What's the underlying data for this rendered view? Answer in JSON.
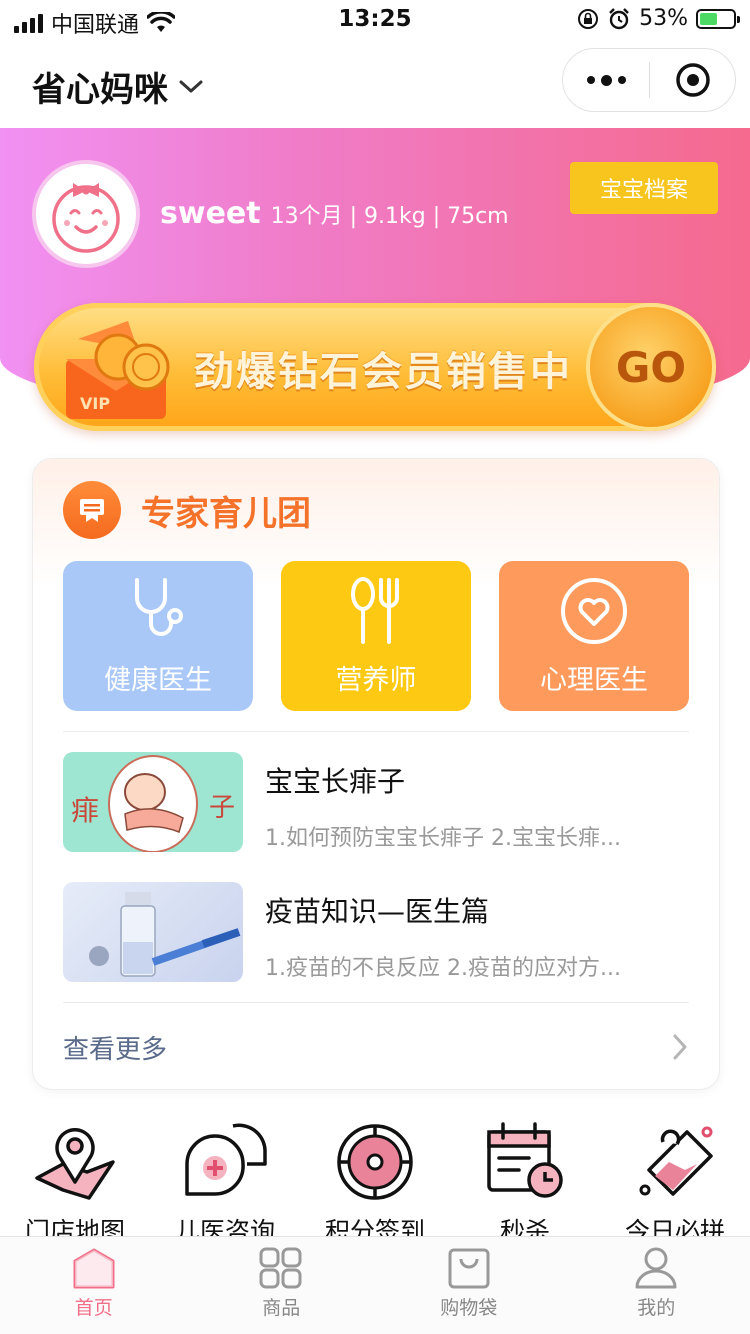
{
  "status_bar": {
    "carrier": "中国联通",
    "time": "13:25",
    "battery_percent": "53%",
    "battery_level": 0.53
  },
  "nav": {
    "title": "省心妈咪"
  },
  "baby": {
    "name": "sweet",
    "info": "13个月 | 9.1kg | 75cm",
    "archive_button": "宝宝档案"
  },
  "promo": {
    "text": "劲爆钻石会员销售中",
    "go_label": "GO",
    "vip_label": "VIP"
  },
  "expert": {
    "title": "专家育儿团",
    "tiles": [
      {
        "label": "健康医生",
        "color": "#a9c8f8",
        "icon": "stethoscope-icon"
      },
      {
        "label": "营养师",
        "color": "#fdc912",
        "icon": "spoon-fork-icon"
      },
      {
        "label": "心理医生",
        "color": "#fe9a5c",
        "icon": "heart-circle-icon"
      }
    ],
    "articles": [
      {
        "title": "宝宝长痱子",
        "desc": "1.如何预防宝宝长痱子 2.宝宝长痱...",
        "thumb_text_left": "痱",
        "thumb_text_right": "子"
      },
      {
        "title": "疫苗知识—医生篇",
        "desc": "1.疫苗的不良反应 2.疫苗的应对方..."
      }
    ],
    "more_label": "查看更多"
  },
  "quick": [
    {
      "label": "门店地图",
      "icon": "map-pin-icon"
    },
    {
      "label": "儿医咨询",
      "icon": "medical-chat-icon"
    },
    {
      "label": "积分签到",
      "icon": "points-checkin-icon"
    },
    {
      "label": "秒杀",
      "icon": "calendar-clock-icon"
    },
    {
      "label": "今日必拼",
      "icon": "group-buy-icon"
    }
  ],
  "tabbar": [
    {
      "label": "首页",
      "icon": "home-icon",
      "active": true
    },
    {
      "label": "商品",
      "icon": "grid-icon",
      "active": false
    },
    {
      "label": "购物袋",
      "icon": "bag-icon",
      "active": false
    },
    {
      "label": "我的",
      "icon": "user-icon",
      "active": false
    }
  ],
  "colors": {
    "accent": "#f0708a",
    "expert_orange": "#f5722a",
    "archive_yellow": "#f7c51d"
  }
}
